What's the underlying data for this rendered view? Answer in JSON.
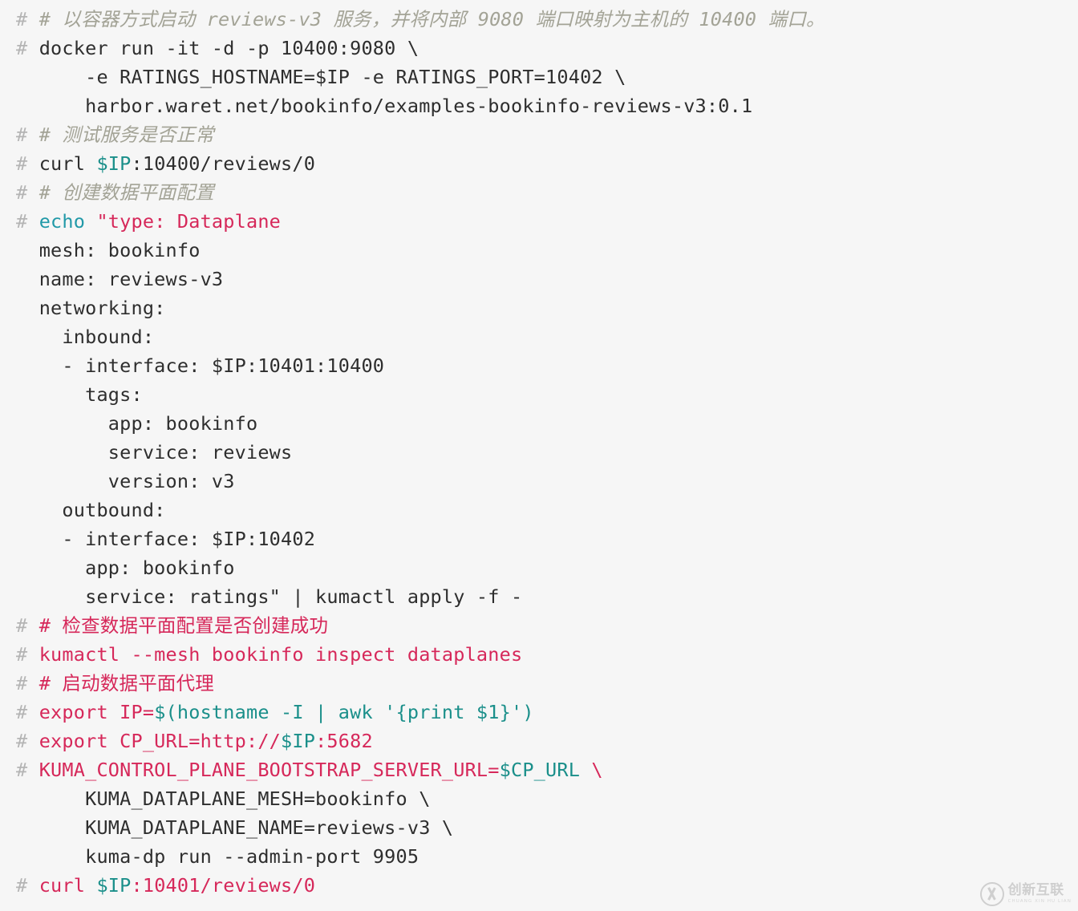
{
  "document": {
    "kind": "terminal-code-snippet",
    "background_color": "#f6f6f6",
    "colors": {
      "prompt": "#b4b4b4",
      "plain": "#2e2e2e",
      "comment": "#a3a396",
      "command_red": "#d6285a",
      "variable_teal": "#1a8f8a",
      "keyword_blue": "#2199a8"
    },
    "prompt_symbol": "#",
    "lines": [
      {
        "prompt": true,
        "tokens": [
          {
            "t": "comment",
            "s": "# 以容器方式启动 reviews-v3 服务，并将内部 9080 端口映射为主机的 10400 端口。"
          }
        ]
      },
      {
        "prompt": true,
        "tokens": [
          {
            "t": "plain",
            "s": "docker run -it -d -p 10400:9080 \\"
          }
        ]
      },
      {
        "prompt": false,
        "tokens": [
          {
            "t": "plain",
            "s": "    -e RATINGS_HOSTNAME=$IP -e RATINGS_PORT=10402 \\"
          }
        ]
      },
      {
        "prompt": false,
        "tokens": [
          {
            "t": "plain",
            "s": "    harbor.waret.net/bookinfo/examples-bookinfo-reviews-v3:0.1"
          }
        ]
      },
      {
        "prompt": true,
        "tokens": [
          {
            "t": "comment",
            "s": "# 测试服务是否正常"
          }
        ]
      },
      {
        "prompt": true,
        "tokens": [
          {
            "t": "plain",
            "s": "curl "
          },
          {
            "t": "var",
            "s": "$IP"
          },
          {
            "t": "plain",
            "s": ":10400/reviews/0"
          }
        ]
      },
      {
        "prompt": true,
        "tokens": [
          {
            "t": "comment",
            "s": "# 创建数据平面配置"
          }
        ]
      },
      {
        "prompt": true,
        "tokens": [
          {
            "t": "kw",
            "s": "echo "
          },
          {
            "t": "str",
            "s": "\"type: Dataplane"
          }
        ]
      },
      {
        "prompt": false,
        "tokens": [
          {
            "t": "plain",
            "s": "mesh: bookinfo"
          }
        ]
      },
      {
        "prompt": false,
        "tokens": [
          {
            "t": "plain",
            "s": "name: reviews-v3"
          }
        ]
      },
      {
        "prompt": false,
        "tokens": [
          {
            "t": "plain",
            "s": "networking:"
          }
        ]
      },
      {
        "prompt": false,
        "tokens": [
          {
            "t": "plain",
            "s": "  inbound:"
          }
        ]
      },
      {
        "prompt": false,
        "tokens": [
          {
            "t": "plain",
            "s": "  - interface: $IP:10401:10400"
          }
        ]
      },
      {
        "prompt": false,
        "tokens": [
          {
            "t": "plain",
            "s": "    tags:"
          }
        ]
      },
      {
        "prompt": false,
        "tokens": [
          {
            "t": "plain",
            "s": "      app: bookinfo"
          }
        ]
      },
      {
        "prompt": false,
        "tokens": [
          {
            "t": "plain",
            "s": "      service: reviews"
          }
        ]
      },
      {
        "prompt": false,
        "tokens": [
          {
            "t": "plain",
            "s": "      version: v3"
          }
        ]
      },
      {
        "prompt": false,
        "tokens": [
          {
            "t": "plain",
            "s": "  outbound:"
          }
        ]
      },
      {
        "prompt": false,
        "tokens": [
          {
            "t": "plain",
            "s": "  - interface: $IP:10402"
          }
        ]
      },
      {
        "prompt": false,
        "tokens": [
          {
            "t": "plain",
            "s": "    app: bookinfo"
          }
        ]
      },
      {
        "prompt": false,
        "tokens": [
          {
            "t": "plain",
            "s": "    service: ratings\" | kumactl apply -f -"
          }
        ]
      },
      {
        "prompt": true,
        "tokens": [
          {
            "t": "cmd",
            "s": "# 检查数据平面配置是否创建成功"
          }
        ]
      },
      {
        "prompt": true,
        "tokens": [
          {
            "t": "cmd",
            "s": "kumactl --mesh bookinfo inspect dataplanes"
          }
        ]
      },
      {
        "prompt": true,
        "tokens": [
          {
            "t": "cmd",
            "s": "# 启动数据平面代理"
          }
        ]
      },
      {
        "prompt": true,
        "tokens": [
          {
            "t": "cmd",
            "s": "export IP="
          },
          {
            "t": "var",
            "s": "$(hostname -I | awk '{print $1}')"
          }
        ]
      },
      {
        "prompt": true,
        "tokens": [
          {
            "t": "cmd",
            "s": "export CP_URL=http://"
          },
          {
            "t": "var",
            "s": "$IP"
          },
          {
            "t": "cmd",
            "s": ":5682"
          }
        ]
      },
      {
        "prompt": true,
        "tokens": [
          {
            "t": "cmd",
            "s": "KUMA_CONTROL_PLANE_BOOTSTRAP_SERVER_URL="
          },
          {
            "t": "var",
            "s": "$CP_URL"
          },
          {
            "t": "cmd",
            "s": " \\"
          }
        ]
      },
      {
        "prompt": false,
        "tokens": [
          {
            "t": "plain",
            "s": "    KUMA_DATAPLANE_MESH=bookinfo \\"
          }
        ]
      },
      {
        "prompt": false,
        "tokens": [
          {
            "t": "plain",
            "s": "    KUMA_DATAPLANE_NAME=reviews-v3 \\"
          }
        ]
      },
      {
        "prompt": false,
        "tokens": [
          {
            "t": "plain",
            "s": "    kuma-dp run --admin-port 9905"
          }
        ]
      },
      {
        "prompt": true,
        "tokens": [
          {
            "t": "cmd",
            "s": "curl "
          },
          {
            "t": "var",
            "s": "$IP"
          },
          {
            "t": "cmd",
            "s": ":10401/reviews/0"
          }
        ]
      }
    ]
  },
  "watermark": {
    "mark": "cx-circle-logo",
    "cn_text": "创新互联",
    "en_text": "CHUANG XIN HU LIAN"
  }
}
